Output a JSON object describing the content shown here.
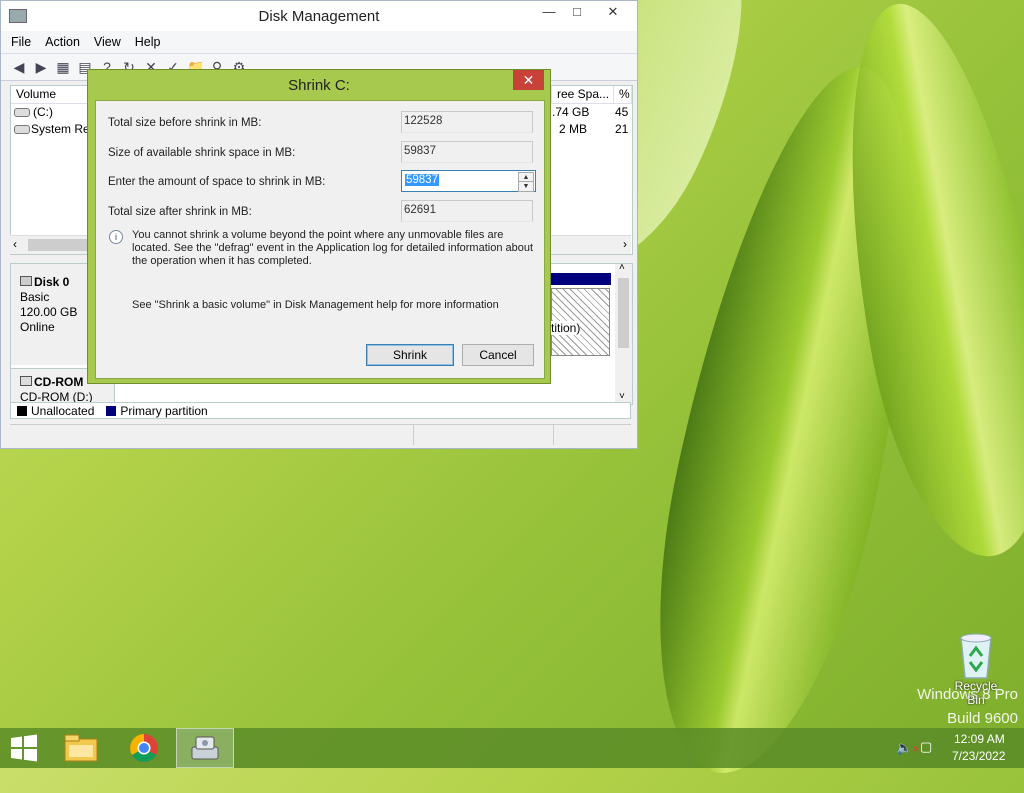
{
  "desktop": {
    "watermark_line1": "Windows 8 Pro",
    "watermark_line2": "Build 9600",
    "recycle_bin_label": "Recycle Bin"
  },
  "window": {
    "title": "Disk Management",
    "menu": [
      "File",
      "Action",
      "View",
      "Help"
    ],
    "volume_headers": [
      "Volume",
      "ree Spa...",
      "% F"
    ],
    "volumes": [
      {
        "name": "(C:)",
        "free": ".74 GB",
        "pct": "45"
      },
      {
        "name": "System Res",
        "free": "2 MB",
        "pct": "21"
      }
    ],
    "disks": [
      {
        "title": "Disk 0",
        "type": "Basic",
        "size": "120.00 GB",
        "status": "Online",
        "partition_label": "tition)"
      },
      {
        "title": "CD-ROM",
        "device": "CD-ROM (D:)"
      }
    ],
    "legend": {
      "unallocated": "Unallocated",
      "primary": "Primary partition"
    }
  },
  "dialog": {
    "title": "Shrink C:",
    "rows": [
      {
        "label": "Total size before shrink in MB:",
        "value": "122528"
      },
      {
        "label": "Size of available shrink space in MB:",
        "value": "59837"
      },
      {
        "label": "Enter the amount of space to shrink in MB:",
        "value": "59837"
      },
      {
        "label": "Total size after shrink in MB:",
        "value": "62691"
      }
    ],
    "info_text": "You cannot shrink a volume beyond the point where any unmovable files are located. See the \"defrag\" event in the Application log for detailed information about the operation when it has completed.",
    "help_text": "See \"Shrink a basic volume\" in Disk Management help for more information",
    "shrink_label": "Shrink",
    "cancel_label": "Cancel"
  },
  "taskbar": {
    "time": "12:09 AM",
    "date": "7/23/2022"
  },
  "colors": {
    "dialog_frame": "#a7c94e",
    "close_red": "#c8423a",
    "primary_partition": "#00007f",
    "selection_blue": "#3399ff"
  },
  "icons": [
    "minimize-icon",
    "maximize-icon",
    "close-icon",
    "back-icon",
    "forward-icon",
    "info-icon",
    "recycle-bin-icon",
    "start-icon",
    "file-explorer-icon",
    "chrome-icon",
    "disk-management-icon",
    "speaker-muted-icon",
    "network-icon"
  ]
}
